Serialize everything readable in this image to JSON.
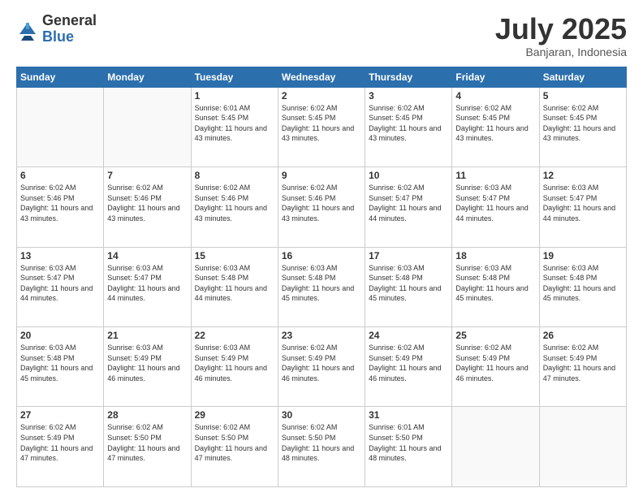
{
  "logo": {
    "general": "General",
    "blue": "Blue"
  },
  "header": {
    "month": "July 2025",
    "location": "Banjaran, Indonesia"
  },
  "days_of_week": [
    "Sunday",
    "Monday",
    "Tuesday",
    "Wednesday",
    "Thursday",
    "Friday",
    "Saturday"
  ],
  "weeks": [
    [
      {
        "day": "",
        "info": ""
      },
      {
        "day": "",
        "info": ""
      },
      {
        "day": "1",
        "info": "Sunrise: 6:01 AM\nSunset: 5:45 PM\nDaylight: 11 hours and 43 minutes."
      },
      {
        "day": "2",
        "info": "Sunrise: 6:02 AM\nSunset: 5:45 PM\nDaylight: 11 hours and 43 minutes."
      },
      {
        "day": "3",
        "info": "Sunrise: 6:02 AM\nSunset: 5:45 PM\nDaylight: 11 hours and 43 minutes."
      },
      {
        "day": "4",
        "info": "Sunrise: 6:02 AM\nSunset: 5:45 PM\nDaylight: 11 hours and 43 minutes."
      },
      {
        "day": "5",
        "info": "Sunrise: 6:02 AM\nSunset: 5:45 PM\nDaylight: 11 hours and 43 minutes."
      }
    ],
    [
      {
        "day": "6",
        "info": "Sunrise: 6:02 AM\nSunset: 5:46 PM\nDaylight: 11 hours and 43 minutes."
      },
      {
        "day": "7",
        "info": "Sunrise: 6:02 AM\nSunset: 5:46 PM\nDaylight: 11 hours and 43 minutes."
      },
      {
        "day": "8",
        "info": "Sunrise: 6:02 AM\nSunset: 5:46 PM\nDaylight: 11 hours and 43 minutes."
      },
      {
        "day": "9",
        "info": "Sunrise: 6:02 AM\nSunset: 5:46 PM\nDaylight: 11 hours and 43 minutes."
      },
      {
        "day": "10",
        "info": "Sunrise: 6:02 AM\nSunset: 5:47 PM\nDaylight: 11 hours and 44 minutes."
      },
      {
        "day": "11",
        "info": "Sunrise: 6:03 AM\nSunset: 5:47 PM\nDaylight: 11 hours and 44 minutes."
      },
      {
        "day": "12",
        "info": "Sunrise: 6:03 AM\nSunset: 5:47 PM\nDaylight: 11 hours and 44 minutes."
      }
    ],
    [
      {
        "day": "13",
        "info": "Sunrise: 6:03 AM\nSunset: 5:47 PM\nDaylight: 11 hours and 44 minutes."
      },
      {
        "day": "14",
        "info": "Sunrise: 6:03 AM\nSunset: 5:47 PM\nDaylight: 11 hours and 44 minutes."
      },
      {
        "day": "15",
        "info": "Sunrise: 6:03 AM\nSunset: 5:48 PM\nDaylight: 11 hours and 44 minutes."
      },
      {
        "day": "16",
        "info": "Sunrise: 6:03 AM\nSunset: 5:48 PM\nDaylight: 11 hours and 45 minutes."
      },
      {
        "day": "17",
        "info": "Sunrise: 6:03 AM\nSunset: 5:48 PM\nDaylight: 11 hours and 45 minutes."
      },
      {
        "day": "18",
        "info": "Sunrise: 6:03 AM\nSunset: 5:48 PM\nDaylight: 11 hours and 45 minutes."
      },
      {
        "day": "19",
        "info": "Sunrise: 6:03 AM\nSunset: 5:48 PM\nDaylight: 11 hours and 45 minutes."
      }
    ],
    [
      {
        "day": "20",
        "info": "Sunrise: 6:03 AM\nSunset: 5:48 PM\nDaylight: 11 hours and 45 minutes."
      },
      {
        "day": "21",
        "info": "Sunrise: 6:03 AM\nSunset: 5:49 PM\nDaylight: 11 hours and 46 minutes."
      },
      {
        "day": "22",
        "info": "Sunrise: 6:03 AM\nSunset: 5:49 PM\nDaylight: 11 hours and 46 minutes."
      },
      {
        "day": "23",
        "info": "Sunrise: 6:02 AM\nSunset: 5:49 PM\nDaylight: 11 hours and 46 minutes."
      },
      {
        "day": "24",
        "info": "Sunrise: 6:02 AM\nSunset: 5:49 PM\nDaylight: 11 hours and 46 minutes."
      },
      {
        "day": "25",
        "info": "Sunrise: 6:02 AM\nSunset: 5:49 PM\nDaylight: 11 hours and 46 minutes."
      },
      {
        "day": "26",
        "info": "Sunrise: 6:02 AM\nSunset: 5:49 PM\nDaylight: 11 hours and 47 minutes."
      }
    ],
    [
      {
        "day": "27",
        "info": "Sunrise: 6:02 AM\nSunset: 5:49 PM\nDaylight: 11 hours and 47 minutes."
      },
      {
        "day": "28",
        "info": "Sunrise: 6:02 AM\nSunset: 5:50 PM\nDaylight: 11 hours and 47 minutes."
      },
      {
        "day": "29",
        "info": "Sunrise: 6:02 AM\nSunset: 5:50 PM\nDaylight: 11 hours and 47 minutes."
      },
      {
        "day": "30",
        "info": "Sunrise: 6:02 AM\nSunset: 5:50 PM\nDaylight: 11 hours and 48 minutes."
      },
      {
        "day": "31",
        "info": "Sunrise: 6:01 AM\nSunset: 5:50 PM\nDaylight: 11 hours and 48 minutes."
      },
      {
        "day": "",
        "info": ""
      },
      {
        "day": "",
        "info": ""
      }
    ]
  ]
}
